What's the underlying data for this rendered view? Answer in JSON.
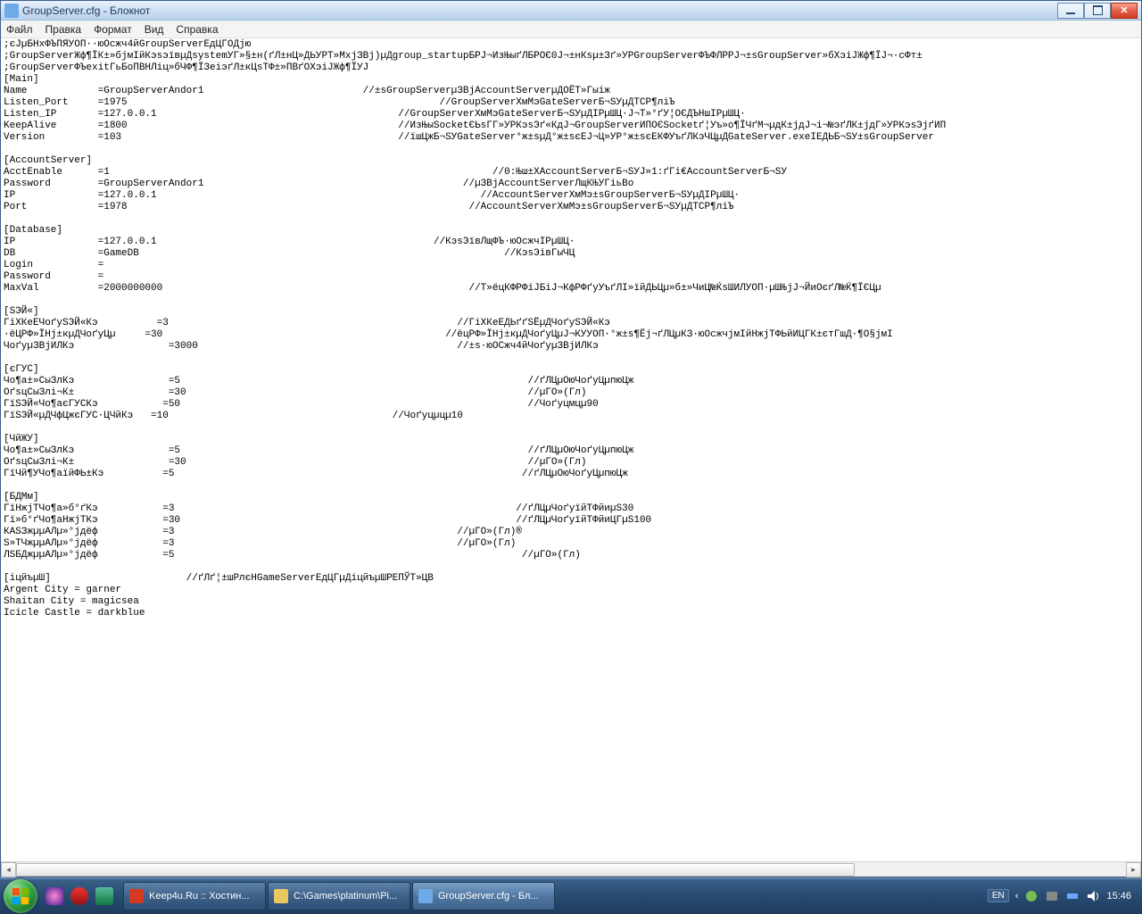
{
  "window": {
    "title": "GroupServer.cfg - Блокнот"
  },
  "menu": {
    "file": "Файл",
    "edit": "Правка",
    "format": "Формат",
    "view": "Вид",
    "help": "Справка"
  },
  "content": ";єЈµБНхФЪПЯУОП··юОсжч4йGroupServerЕдЦГОДјю\n;GroupServerЖф¶ЇК±»бјмІйКэsэївµДsystemУГ»§±н(ґЛ±нЦ»ДЬУРТ»МхјЗВј)µДgroup_startupБРЈ¬ИзЊыґЛБРОЄ0Ј¬±нКѕµ±Зґ»УРGroupServerФЪФЛРРЈ¬±sGroupServer»бХэіЈЖф¶ЇЈ¬·сФт±\n;GroupServerФЪexitГьБоПВНЛіц»бЧФ¶ЇЗеіэґЛ±кЦѕТФ±»ПВґОХэіЈЖф¶ЇУЈ\n[Main]\nName            =GroupServerAndor1                           //±sGroupServerµЗВјAccountServerµДОЁТ»Гыіж\nListen_Port     =1975                                                     //GroupServerХмМэGateServerБ¬SУµДТСР¶ліЪ\nListen_IP       =127.0.0.1                                         //GroupServerХмМэGateServerБ¬SУµДІРµШЦ·Ј¬Т»°ґУ¦ОЄДЪНшІРµШЦ·\nKeepAlive       =1800                                              //ИзЊыSocketЄЬsГГ»УРКэsЭґ«КдЈ¬GroupServerИПОЄSocketґ¦Уъ»о¶ЇЧґМ¬µдК±јдЈ¬і¬№эґЛК±јдГ»УРКэsЭјґИП\nVersion         =103                                               //їшЦжБ¬SУGateServer°ж±sµД°ж±sєЕЈ¬Ц»УР°ж±sєЕКФУъґЛКэЧЦµДGateServer.exeІЕДЬБ¬SУ±sGroupServer\n\n[AccountServer]\nAcctEnable      =1                                                                 //0:Њш±ХAccountServerБ¬SУJ»1:ґГі€AccountServerБ¬SУ\nPassword        =GroupServerAndor1                                            //µЗВјAccountServerЛщКЊУГіьВо\nIP              =127.0.0.1                                                       //AccountServerХмМэ±sGroupServerБ¬SУµДІРµШЦ·\nPort            =1978                                                          //AccountServerХмМэ±sGroupServerБ¬SУµДТСР¶ліЪ\n\n[Database]\nIP              =127.0.0.1                                               //КэsЭївЛщФЪ·юОсжчІРµШЦ·\nDB              =GameDB                                                              //КэsЭівГыЧЦ\nLogin           =\nPassword        =\nMaxVal          =2000000000                                                    //Т»ёцКФРФіЈБіЈ¬КфРФґуУъґЛІ»їйДЬЦµ»б±»ЧиЦ№ЌѕШИЛУОП·µШЊјЈ¬ЙиОєґЛ№Ќ¶ЇЄЦµ\n\n[SЭЙ«]\nГіХКеЕЧоґуSЭЙ«Кэ          =3                                                 //ГіХКеЕДЬґґЅЁµДЧоґуSЭЙ«Кэ\n·ёЦРФ»ЇНј±кµДЧоґуЦµ     =30                                                //ёцРФ»ЇНј±кµДЧоґуЦµЈ¬КУУОП·°ж±s¶Ёј¬ґЛЦµКЗ·юОсжчјмІйНжјТФЬйИЦГК±єтГшД·¶О§јмІ\nЧоґуµЗВјИЛКэ                =3000                                            //±s·юОСжч4йЧоґуµЗВјИЛКэ\n\n[єГУС]\nЧо¶а±»СыЗлКэ                =5                                                           //ґЛЦµОюЧоґуЦµпюЦж\nОґsцСыЗлі¬К±                =30                                                          //µГО»(Гл)\nГїSЭЙ«Чо¶аєГУСКэ           =50                                                           //Чоґуцмцµ90\nГїSЭЙ«µДЧфЦжєГУС·ЦЧйКэ   =10                                      //Чоґуцµцµ10\n\n[ЧйЖУ]\nЧо¶а±»СыЗлКэ                =5                                                           //ґЛЦµОюЧоґуЦµпюЦж\nОґsцСыЗлі¬К±                =30                                                          //µГО»(Гл)\nГїЧй¶УЧо¶аїйФЬ±Кэ          =5                                                           //ґЛЦµОюЧоґуЦµпюЦж\n\n[БДМм]\nГїНжјТЧо¶а»б°ґКэ           =3                                                          //ґЛЦµЧоґуїйТФйиµS30\nГї»б°ґЧо¶аНжјТКэ           =30                                                         //ґЛЦµЧоґуїйТФйиЦГµS100\nКАSЗжµµАЛµ»°јдёф           =3                                                //µГО»(Гл)®\nS»ТЧжµµАЛµ»°јдёф           =3                                                //µГО»(Гл)\nЛЅБДжµµАЛµ»°јдёф           =5                                                           //µГО»(Гл)\n\n[іцйъµШ]                       //ґЛґ¦±шРлєНGameServerЕдЦГµДіцйъµШРЕПЎТ»ЦВ\nArgent City = garner\nShaitan City = magicsea\nIcicle Castle = darkblue",
  "taskbar": {
    "items": [
      {
        "label": "Keep4u.Ru :: Хостин...",
        "color": "#d33a20"
      },
      {
        "label": "C:\\Games\\platinum\\Pi...",
        "color": "#e8c860"
      },
      {
        "label": "GroupServer.cfg - Бл...",
        "color": "#6ea9e8"
      }
    ],
    "lang": "EN",
    "time": "15:46"
  }
}
